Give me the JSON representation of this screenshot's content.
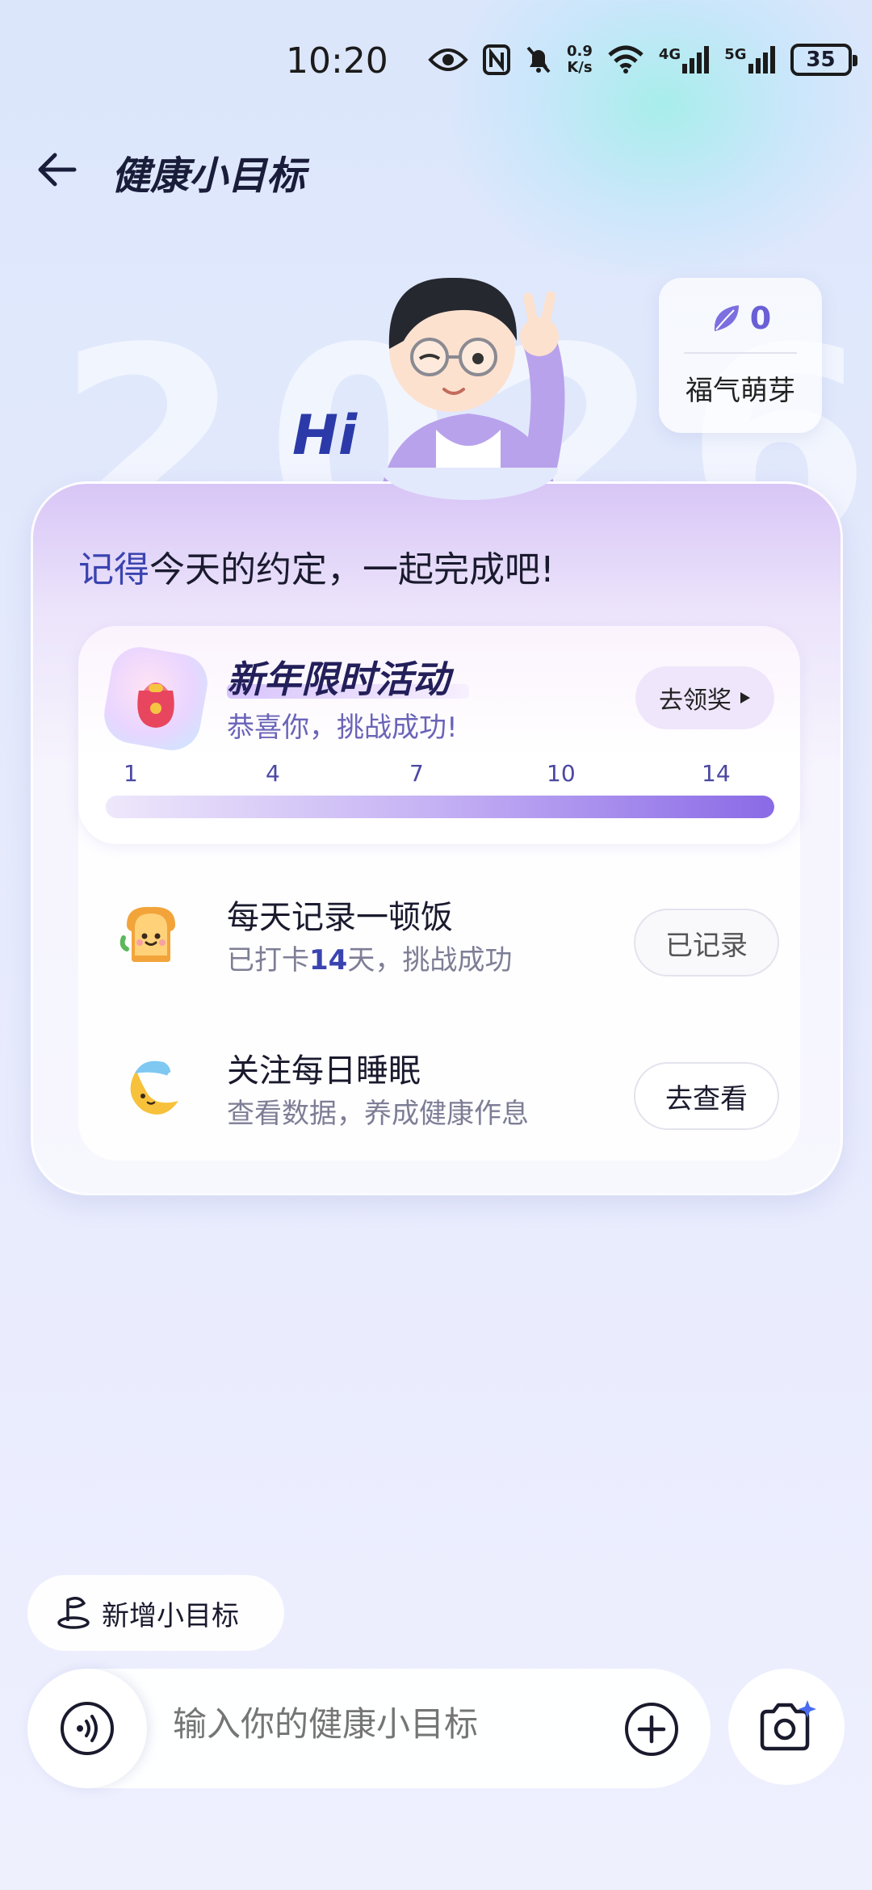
{
  "status_bar": {
    "time": "10:20",
    "net_speed_value": "0.9",
    "net_speed_unit": "K/s",
    "sim1": "4G",
    "sim2": "5G",
    "battery": "35"
  },
  "header": {
    "title": "健康小目标"
  },
  "hero": {
    "big_year": "2026",
    "greeting": "Hi",
    "badge": {
      "count": "0",
      "label": "福气萌芽",
      "icon": "leaf-icon",
      "accent": "#6a5fd6"
    }
  },
  "card": {
    "reminder_highlight": "记得",
    "reminder_rest": "今天的约定，一起完成吧!",
    "event": {
      "title": "新年限时活动",
      "subtitle": "恭喜你，挑战成功!",
      "button_label": "去领奖",
      "ticks": [
        "1",
        "4",
        "7",
        "10",
        "14"
      ],
      "progress": 1.0
    },
    "tasks": [
      {
        "title": "每天记录一顿饭",
        "sub_prefix": "已打卡",
        "sub_count": "14",
        "sub_suffix": "天，挑战成功",
        "button_label": "已记录",
        "icon": "toast-icon"
      },
      {
        "title": "关注每日睡眠",
        "sub_text": "查看数据，养成健康作息",
        "button_label": "去查看",
        "icon": "moon-icon"
      }
    ]
  },
  "bottom": {
    "add_goal_label": "新增小目标",
    "input_placeholder": "输入你的健康小目标"
  },
  "colors": {
    "accent": "#3a44b0",
    "progress_end": "#8a6ae6"
  }
}
